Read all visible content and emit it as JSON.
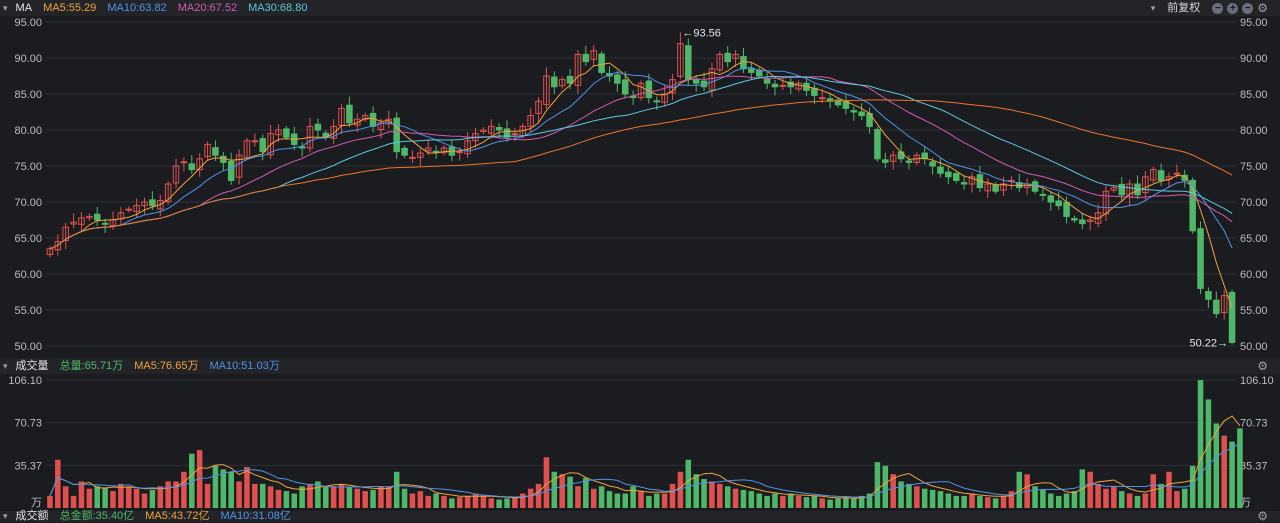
{
  "header": {
    "indicator": "MA",
    "ma5": "MA5:55.29",
    "ma10": "MA10:63.82",
    "ma20": "MA20:67.52",
    "ma30": "MA30:68.80",
    "adjust": "前复权"
  },
  "volume_header": {
    "title": "成交量",
    "total": "总量:65.71万",
    "ma5": "MA5:76.65万",
    "ma10": "MA10:51.03万"
  },
  "amount_header": {
    "title": "成交额",
    "total": "总金额:35.40亿",
    "ma5": "MA5:43.72亿",
    "ma10": "MA10:31.08亿"
  },
  "colors": {
    "up": "#e0504f",
    "down": "#4fb868",
    "ma5": "#f0a23c",
    "ma10": "#4e93e8",
    "ma20": "#d25ab0",
    "ma30": "#5bc8e0",
    "ma60": "#e8742c"
  },
  "chart_data": [
    {
      "type": "candlestick",
      "ylim": [
        50,
        95
      ],
      "yticks": [
        "95.00",
        "90.00",
        "85.00",
        "80.00",
        "75.00",
        "70.00",
        "65.00",
        "60.00",
        "55.00",
        "50.00"
      ],
      "annotations": {
        "high": "←93.56",
        "low": "50.22→"
      },
      "closes": [
        63.5,
        64.5,
        66.5,
        67.2,
        67.8,
        68.0,
        67.5,
        66.9,
        67.5,
        68.5,
        69.0,
        69.5,
        70.0,
        69.5,
        70.2,
        72.5,
        75.0,
        75.6,
        74.5,
        76.0,
        78.0,
        76.5,
        75.5,
        73.0,
        76.5,
        78.5,
        78.5,
        77.0,
        79.5,
        80.0,
        79.0,
        78.0,
        77.5,
        80.5,
        80.0,
        79.0,
        80.5,
        83.0,
        81.0,
        81.5,
        82.0,
        80.5,
        81.0,
        81.5,
        77.0,
        76.5,
        76.2,
        76.8,
        77.5,
        77.0,
        77.5,
        76.5,
        77.0,
        78.5,
        79.5,
        80.0,
        80.5,
        80.0,
        79.0,
        79.5,
        80.5,
        82.0,
        84.0,
        87.5,
        86.0,
        87.0,
        86.5,
        90.5,
        89.5,
        91.0,
        88.0,
        87.5,
        86.5,
        85.0,
        84.5,
        86.5,
        84.5,
        84.0,
        85.0,
        87.0,
        92.0,
        87.0,
        86.5,
        86.0,
        88.5,
        90.5,
        89.5,
        90.5,
        88.5,
        88.0,
        87.5,
        86.5,
        86.0,
        86.2,
        86.0,
        86.5,
        85.5,
        84.8,
        84.5,
        84.0,
        83.5,
        83.0,
        82.5,
        82.0,
        80.5,
        76.0,
        75.5,
        76.5,
        76.0,
        75.5,
        76.5,
        76.0,
        75.0,
        74.0,
        73.5,
        73.0,
        72.5,
        73.5,
        72.0,
        72.5,
        71.5,
        72.5,
        73.0,
        72.0,
        72.5,
        71.5,
        71.0,
        70.0,
        69.5,
        68.0,
        67.5,
        67.0,
        67.5,
        68.5,
        71.5,
        72.0,
        71.0,
        72.5,
        71.0,
        73.5,
        74.5,
        73.0,
        73.5,
        74.0,
        73.0,
        66.0,
        58.0,
        56.5,
        54.5,
        57.0,
        50.5
      ],
      "highs_at_peak": 93.56,
      "low_at_end": 50.22,
      "ma_lines": [
        "MA5",
        "MA10",
        "MA20",
        "MA30",
        "MA60"
      ]
    },
    {
      "type": "bar",
      "title": "成交量",
      "unit": "万",
      "ylim": [
        0,
        106.1
      ],
      "yticks": [
        "106.10",
        "70.73",
        "35.37",
        "万"
      ],
      "values": [
        10,
        40,
        18,
        10,
        22,
        16,
        18,
        17,
        14,
        20,
        18,
        16,
        12,
        15,
        18,
        22,
        22,
        30,
        45,
        48,
        20,
        35,
        32,
        30,
        22,
        34,
        20,
        20,
        18,
        15,
        14,
        12,
        18,
        20,
        22,
        18,
        18,
        20,
        17,
        16,
        14,
        15,
        18,
        18,
        30,
        16,
        12,
        14,
        10,
        12,
        10,
        8,
        9,
        10,
        12,
        10,
        8,
        7,
        8,
        9,
        12,
        16,
        20,
        42,
        30,
        28,
        26,
        18,
        25,
        16,
        18,
        14,
        12,
        12,
        18,
        14,
        10,
        12,
        12,
        20,
        30,
        40,
        28,
        24,
        22,
        20,
        18,
        16,
        15,
        14,
        12,
        10,
        12,
        10,
        12,
        10,
        9,
        10,
        8,
        7,
        8,
        9,
        8,
        10,
        12,
        38,
        35,
        28,
        22,
        20,
        18,
        16,
        15,
        14,
        12,
        10,
        10,
        12,
        10,
        9,
        8,
        10,
        14,
        30,
        28,
        18,
        15,
        12,
        10,
        12,
        14,
        32,
        30,
        20,
        16,
        18,
        14,
        12,
        10,
        12,
        28,
        20,
        30,
        14,
        16,
        35,
        106,
        90,
        70,
        60,
        55,
        66
      ]
    }
  ]
}
